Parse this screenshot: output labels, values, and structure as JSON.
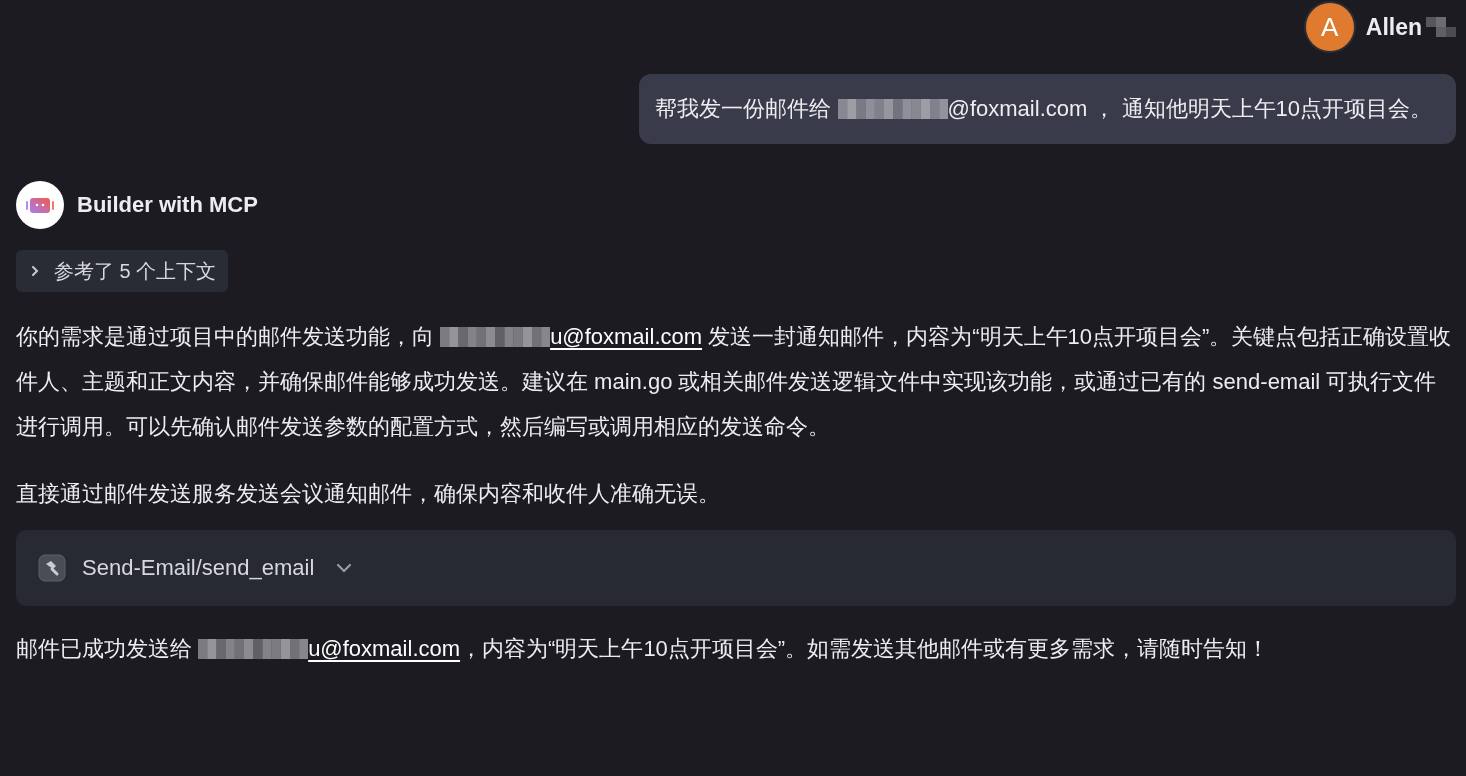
{
  "user": {
    "avatar_letter": "A",
    "name": "Allen",
    "name_redacted": true,
    "message": [
      {
        "kind": "text",
        "text": "帮我发一份邮件给 "
      },
      {
        "kind": "redacted"
      },
      {
        "kind": "text",
        "text": "@foxmail.com ， 通知他明天上午10点开项目会。"
      }
    ]
  },
  "assistant": {
    "name": "Builder with MCP",
    "context": {
      "label": "参考了 5 个上下文",
      "expanded": false
    },
    "paragraphs": [
      [
        {
          "kind": "text",
          "text": "你的需求是通过项目中的邮件发送功能，向 "
        },
        {
          "kind": "redacted"
        },
        {
          "kind": "link",
          "text": "u@foxmail.com"
        },
        {
          "kind": "text",
          "text": " 发送一封通知邮件，内容为“明天上午10点开项目会”。关键点包括正确设置收件人、主题和正文内容，并确保邮件能够成功发送。建议在 main.go 或相关邮件发送逻辑文件中实现该功能，或通过已有的 send-email 可执行文件进行调用。可以先确认邮件发送参数的配置方式，然后编写或调用相应的发送命令。"
        }
      ],
      [
        {
          "kind": "text",
          "text": "直接通过邮件发送服务发送会议通知邮件，确保内容和收件人准确无误。"
        }
      ]
    ],
    "tool_call": {
      "label": "Send-Email/send_email",
      "expanded": false
    },
    "reply": [
      {
        "kind": "text",
        "text": "邮件已成功发送给 "
      },
      {
        "kind": "redacted"
      },
      {
        "kind": "link",
        "text": "u@foxmail.com"
      },
      {
        "kind": "text",
        "text": "，内容为“明天上午10点开项目会”。如需发送其他邮件或有更多需求，请随时告知！"
      }
    ]
  }
}
